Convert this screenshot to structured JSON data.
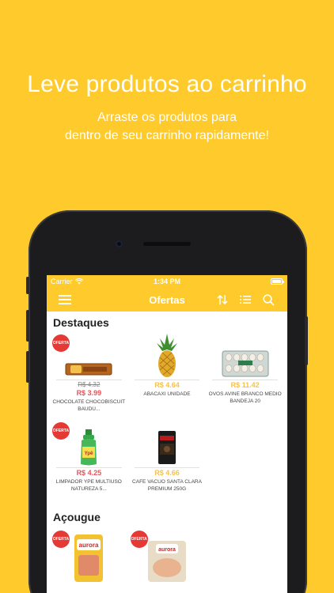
{
  "promo": {
    "title": "Leve produtos ao carrinho",
    "subtitle_line1": "Arraste os produtos para",
    "subtitle_line2": "dentro de seu carrinho rapidamente!"
  },
  "status_bar": {
    "carrier": "Carrier",
    "time": "1:34 PM",
    "battery_level": 1.0
  },
  "navbar": {
    "title": "Ofertas",
    "icons": [
      "menu-icon",
      "sort-icon",
      "list-icon",
      "search-icon"
    ]
  },
  "colors": {
    "brand": "#FFCA2B",
    "sale_price": "#E5555B",
    "normal_price": "#F6C24C",
    "badge": "#E53935"
  },
  "sections": [
    {
      "title": "Destaques",
      "products": [
        {
          "badge": "OFERTA",
          "old_price": "R$ 4.32",
          "price": "R$ 3.99",
          "price_style": "sale",
          "name": "CHOCOLATE CHOCOBISCUIT BAUDU...",
          "image": "chocolate-bar"
        },
        {
          "badge": "",
          "old_price": "",
          "price": "R$ 4.64",
          "price_style": "normal",
          "name": "ABACAXI UNIDADE",
          "image": "pineapple"
        },
        {
          "badge": "",
          "old_price": "",
          "price": "R$ 11.42",
          "price_style": "normal",
          "name": "OVOS AVINE BRANCO MEDIO BANDEJA 20",
          "image": "egg-tray"
        },
        {
          "badge": "OFERTA",
          "old_price": "",
          "price": "R$ 4.25",
          "price_style": "sale",
          "name": "LIMPADOR YPE MULTIUSO NATUREZA 5...",
          "image": "cleaner-bottle"
        },
        {
          "badge": "",
          "old_price": "",
          "price": "R$ 4.66",
          "price_style": "normal",
          "name": "CAFE VACUO SANTA CLARA PREMIUM 250G",
          "image": "coffee-pack"
        }
      ]
    },
    {
      "title": "Açougue",
      "products": [
        {
          "badge": "OFERTA",
          "image": "aurora-pack-1",
          "brand_text": "aurora"
        },
        {
          "badge": "OFERTA",
          "image": "aurora-pack-2",
          "brand_text": "aurora"
        }
      ]
    }
  ]
}
